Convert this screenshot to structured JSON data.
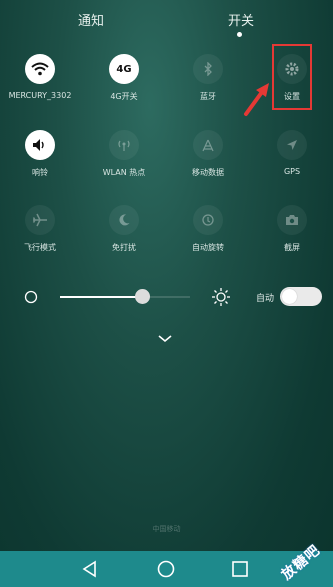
{
  "tabs": {
    "notifications": "通知",
    "switches": "开关"
  },
  "tiles": [
    {
      "label": "MERCURY_3302",
      "icon": "wifi-icon",
      "active": true
    },
    {
      "label": "4G开关",
      "icon": "4g-icon",
      "icon_text": "4G",
      "active": true
    },
    {
      "label": "蓝牙",
      "icon": "bluetooth-icon",
      "active": false
    },
    {
      "label": "设置",
      "icon": "gear-icon",
      "active": false
    },
    {
      "label": "响铃",
      "icon": "speaker-icon",
      "active": true
    },
    {
      "label": "WLAN 热点",
      "icon": "hotspot-icon",
      "active": false
    },
    {
      "label": "移动数据",
      "icon": "mobile-data-icon",
      "active": false
    },
    {
      "label": "GPS",
      "icon": "gps-icon",
      "active": false
    },
    {
      "label": "飞行模式",
      "icon": "airplane-icon",
      "active": false
    },
    {
      "label": "免打扰",
      "icon": "moon-icon",
      "active": false
    },
    {
      "label": "自动旋转",
      "icon": "rotate-icon",
      "active": false
    },
    {
      "label": "截屏",
      "icon": "camera-icon",
      "active": false
    }
  ],
  "brightness": {
    "level_percent": 63,
    "auto_label": "自动",
    "auto_enabled": false
  },
  "carrier": "中国移动",
  "watermark": "放糖吧",
  "colors": {
    "accent_highlight": "#e53935",
    "navbar": "#1e8a8c",
    "background": "#1d5047"
  }
}
